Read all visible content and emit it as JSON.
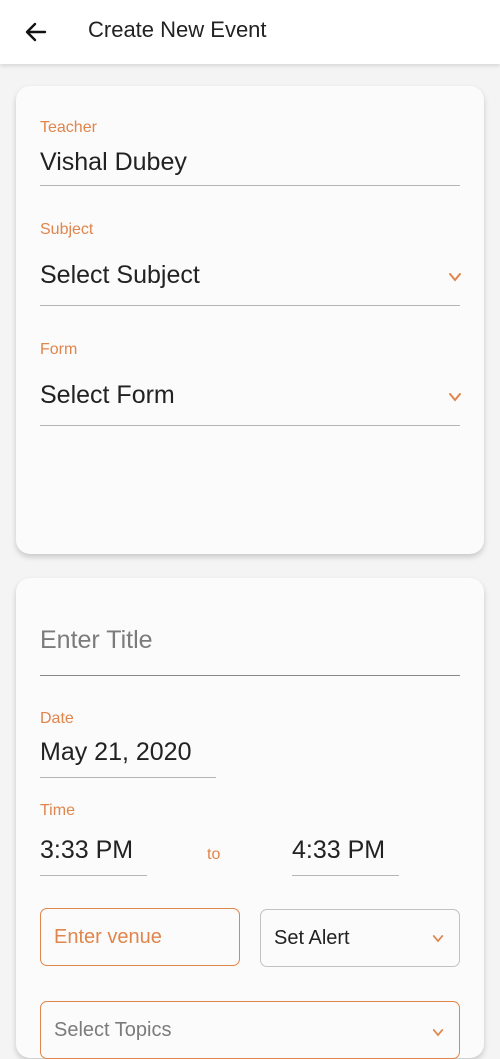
{
  "header": {
    "title": "Create New Event",
    "back_icon": "arrow-left-icon"
  },
  "teacher": {
    "label": "Teacher",
    "value": "Vishal Dubey"
  },
  "subject": {
    "label": "Subject",
    "value": "Select Subject"
  },
  "form": {
    "label": "Form",
    "value": "Select Form"
  },
  "title_field": {
    "placeholder": "Enter Title"
  },
  "date": {
    "label": "Date",
    "value": "May 21, 2020"
  },
  "time": {
    "label": "Time",
    "start": "3:33 PM",
    "separator": "to",
    "end": "4:33 PM"
  },
  "venue": {
    "placeholder": "Enter venue"
  },
  "alert": {
    "value": "Set Alert"
  },
  "topics": {
    "placeholder": "Select Topics"
  },
  "colors": {
    "accent": "#e0854b",
    "card": "#fbfbfb",
    "background": "#f4f4f4"
  }
}
